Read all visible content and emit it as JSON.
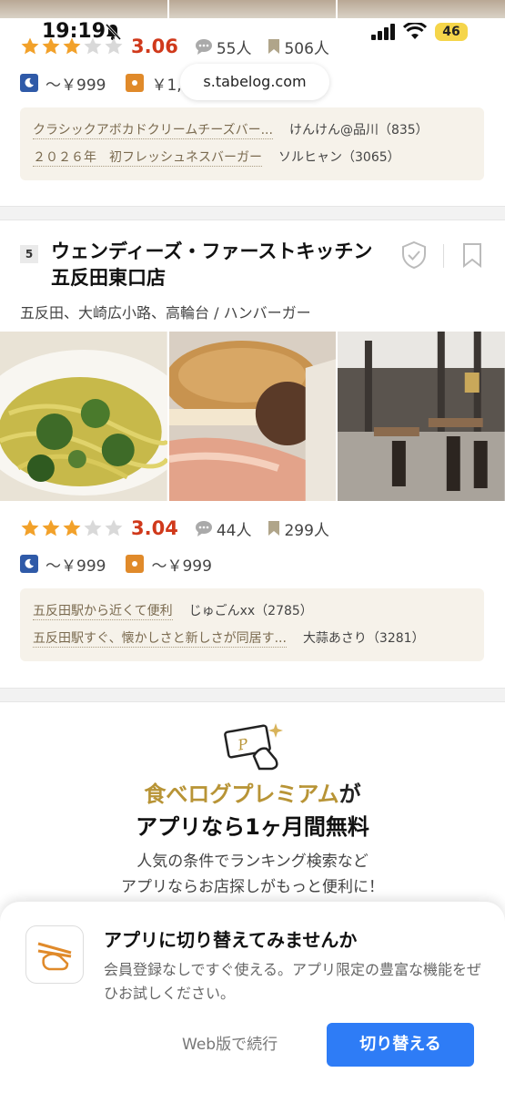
{
  "status_bar": {
    "time": "19:19",
    "battery": "46"
  },
  "browser": {
    "url": "s.tabelog.com"
  },
  "listing_prev": {
    "rating": "3.06",
    "stars_filled": 3,
    "reviews": "55人",
    "bookmarks": "506人",
    "price_dinner": "～￥999",
    "price_lunch": "￥1,",
    "review_snippets": [
      {
        "title": "クラシックアボカドクリームチーズバー...",
        "author": "けんけん@品川（835）"
      },
      {
        "title": "２０２６年　初フレッシュネスバーガー",
        "author": "ソルヒャン（3065）"
      }
    ]
  },
  "listing": {
    "rank": "5",
    "name": "ウェンディーズ・ファーストキッチン 五反田東口店",
    "area": "五反田、大崎広小路、高輪台 / ハンバーガー",
    "rating": "3.04",
    "stars_filled": 3,
    "reviews": "44人",
    "bookmarks": "299人",
    "price_dinner": "～￥999",
    "price_lunch": "～￥999",
    "review_snippets": [
      {
        "title": "五反田駅から近くて便利",
        "author": "じゅごんxx（2785）"
      },
      {
        "title": "五反田駅すぐ、懐かしさと新しさが同居す...",
        "author": "大蒜あさり（3281）"
      }
    ]
  },
  "promo": {
    "title_gold": "食べログプレミアム",
    "title_suffix": "が",
    "title_line2": "アプリなら1ヶ月間無料",
    "desc_line1": "人気の条件でランキング検索など",
    "desc_line2": "アプリならお店探しがもっと便利に！"
  },
  "app_sheet": {
    "title": "アプリに切り替えてみませんか",
    "description": "会員登録なしですぐ使える。アプリ限定の豊富な機能をぜひお試しください。",
    "secondary_button": "Web版で続行",
    "primary_button": "切り替える"
  },
  "colors": {
    "accent": "#2e7cf6",
    "score": "#d0391b",
    "gold": "#b89436",
    "star": "#f2a12a"
  }
}
